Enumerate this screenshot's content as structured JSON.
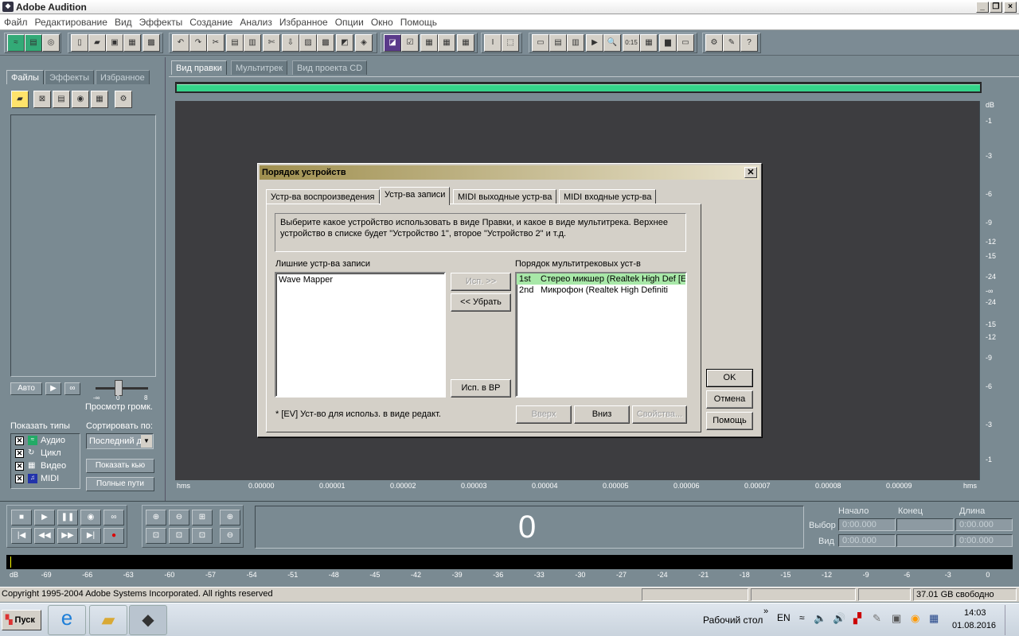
{
  "app": {
    "title": "Adobe Audition"
  },
  "menu": [
    "Файл",
    "Редактирование",
    "Вид",
    "Эффекты",
    "Создание",
    "Анализ",
    "Избранное",
    "Опции",
    "Окно",
    "Помощь"
  ],
  "left_panel": {
    "tabs": [
      "Файлы",
      "Эффекты",
      "Избранное"
    ],
    "auto_label": "Авто",
    "preview_label": "Просмотр громк.",
    "slider_ticks": [
      "-∞",
      "0",
      "8"
    ],
    "show_types_label": "Показать типы",
    "types": [
      "Аудио",
      "Цикл",
      "Видео",
      "MIDI"
    ],
    "sort_label": "Сортировать по:",
    "sort_value": "Последний д",
    "show_queue": "Показать кью",
    "full_paths": "Полные пути"
  },
  "main_tabs": [
    "Вид правки",
    "Мультитрек",
    "Вид проекта CD"
  ],
  "db_scale": [
    "dB",
    "-1",
    "-3",
    "-6",
    "-9",
    "-12",
    "-15",
    "-24",
    "-∞",
    "-24",
    "-15",
    "-12",
    "-9",
    "-6",
    "-3",
    "-1"
  ],
  "time_ruler": [
    "hms",
    "0.00000",
    "0.00001",
    "0.00002",
    "0.00003",
    "0.00004",
    "0.00005",
    "0.00006",
    "0.00007",
    "0.00008",
    "0.00009",
    "hms"
  ],
  "transport": {
    "time_display": "0",
    "headers": [
      "Начало",
      "Конец",
      "Длина"
    ],
    "rows": [
      {
        "label": "Выбор",
        "values": [
          "0:00.000",
          "",
          "0:00.000"
        ]
      },
      {
        "label": "Вид",
        "values": [
          "0:00.000",
          "",
          "0:00.000"
        ]
      }
    ]
  },
  "level_meter": [
    "dB",
    "-69",
    "-66",
    "-63",
    "-60",
    "-57",
    "-54",
    "-51",
    "-48",
    "-45",
    "-42",
    "-39",
    "-36",
    "-33",
    "-30",
    "-27",
    "-24",
    "-21",
    "-18",
    "-15",
    "-12",
    "-9",
    "-6",
    "-3",
    "0"
  ],
  "status": {
    "copyright": "Copyright 1995-2004 Adobe Systems Incorporated. All rights reserved",
    "free_space": "37.01 GB свободно"
  },
  "dialog": {
    "title": "Порядок устройств",
    "tabs": [
      "Устр-ва воспроизведения",
      "Устр-ва записи",
      "MIDI выходные устр-ва",
      "MIDI входные устр-ва"
    ],
    "active_tab": 1,
    "description": "Выберите какое устройство использовать в виде Правки, и какое в виде мультитрека.  Верхнее устройство в списке будет \"Устройство 1\", второе \"Устройство 2\" и т.д.",
    "unused_label": "Лишние устр-ва записи",
    "unused_items": [
      "Wave Mapper"
    ],
    "order_label": "Порядок мультитрековых уст-в",
    "order_items": [
      {
        "num": "1st",
        "name": "Стерео микшер (Realtek High Def [EV"
      },
      {
        "num": "2nd",
        "name": "Микрофон (Realtek High Definiti"
      }
    ],
    "btn_use": "Исп. >>",
    "btn_remove": "<< Убрать",
    "btn_use_edit": "Исп. в ВР",
    "btn_up": "Вверх",
    "btn_down": "Вниз",
    "btn_props": "Свойства...",
    "footnote": "* [EV] Уст-во для использ. в виде редакт.",
    "ok": "OK",
    "cancel": "Отмена",
    "help": "Помощь"
  },
  "taskbar": {
    "start": "Пуск",
    "desktop": "Рабочий стол",
    "lang": "EN",
    "time": "14:03",
    "date": "01.08.2016"
  }
}
